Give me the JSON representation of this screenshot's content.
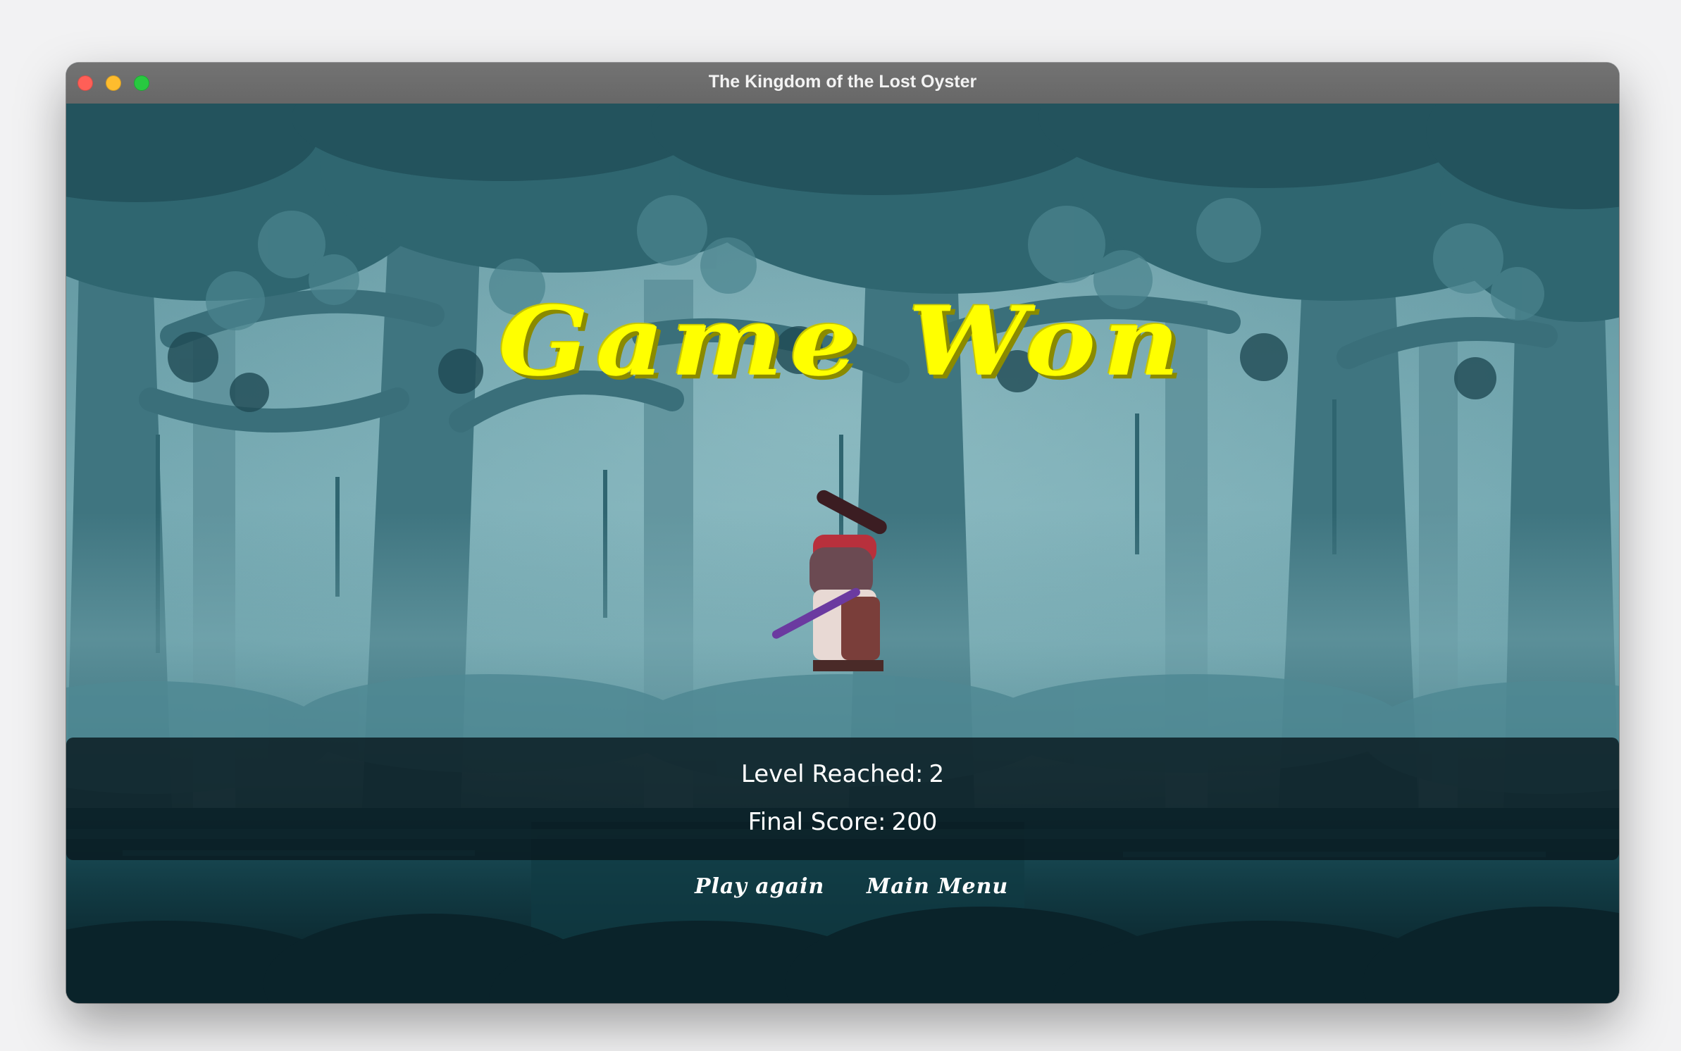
{
  "window": {
    "title": "The Kingdom of the Lost Oyster"
  },
  "game": {
    "headline": "Game Won",
    "stats": {
      "level_label": "Level Reached:",
      "level_value": "2",
      "score_label": "Final Score:",
      "score_value": "200"
    },
    "buttons": {
      "play_again": "Play again",
      "main_menu": "Main Menu"
    }
  },
  "colors": {
    "headline": "#ffff00",
    "sky_fog": "#6fa3ad",
    "canopy": "#2c5f69",
    "ground": "#0a2128"
  },
  "icons": [
    "close-window-icon",
    "minimize-window-icon",
    "maximize-window-icon",
    "samurai-character-sprite"
  ]
}
